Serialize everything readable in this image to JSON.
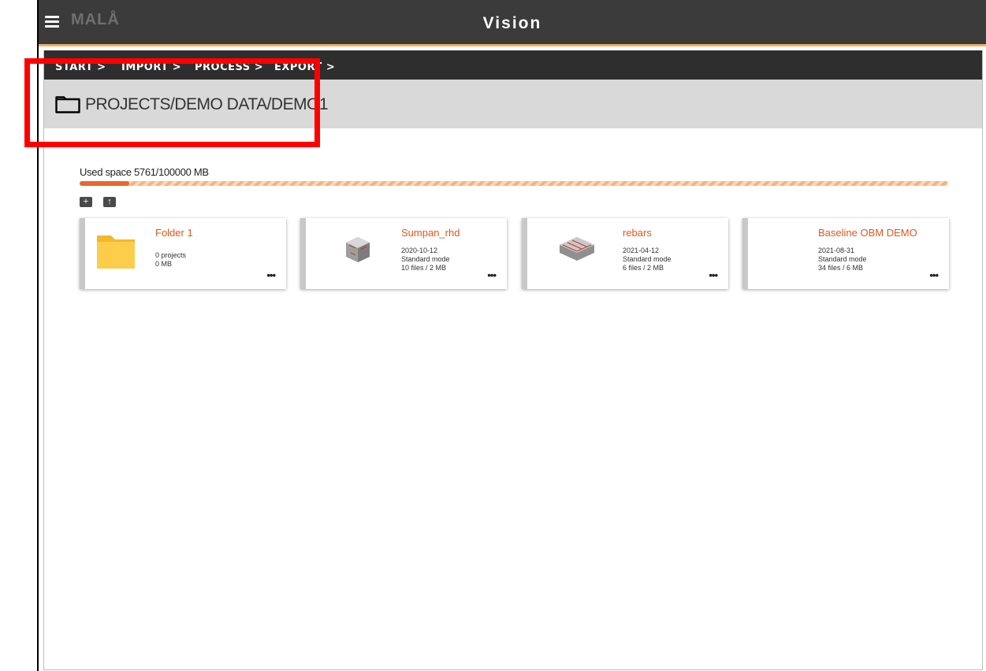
{
  "app": {
    "logo_text": "MALÅ",
    "title": "Vision",
    "accent_color": "#f2a65a"
  },
  "breadcrumb": {
    "items": [
      {
        "label": "START",
        "sep": ">"
      },
      {
        "label": "IMPORT",
        "sep": ">"
      },
      {
        "label": "PROCESS",
        "sep": ">"
      },
      {
        "label": "EXPORT",
        "sep": ">"
      }
    ]
  },
  "path": {
    "icon": "folder-icon",
    "text": "PROJECTS/DEMO DATA/DEMO1"
  },
  "storage": {
    "label": "Used space 5761/100000 MB",
    "used_mb": 5761,
    "total_mb": 100000,
    "fraction_used": 0.0576,
    "fill_color": "#e8692f",
    "track_color": "#f6b37f"
  },
  "toolbar": {
    "new_folder_icon": "new-folder-icon",
    "upload_icon": "upload-icon"
  },
  "cards": [
    {
      "title": "Folder 1",
      "type": "folder",
      "line1": "0 projects",
      "line2": "0 MB",
      "line3": "",
      "menu": "•••"
    },
    {
      "title": "Sumpan_rhd",
      "type": "project",
      "line1": "2020-10-12",
      "line2": "Standard mode",
      "line3": "10 files / 2 MB",
      "menu": "•••"
    },
    {
      "title": "rebars",
      "type": "project",
      "line1": "2021-04-12",
      "line2": "Standard mode",
      "line3": "6 files / 2 MB",
      "menu": "•••"
    },
    {
      "title": "Baseline OBM DEMO",
      "type": "project",
      "line1": "2021-08-31",
      "line2": "Standard mode",
      "line3": "34 files / 6 MB",
      "menu": "•••"
    }
  ],
  "colors": {
    "title_orange": "#e2571e",
    "highlight_red": "#ff0000"
  }
}
